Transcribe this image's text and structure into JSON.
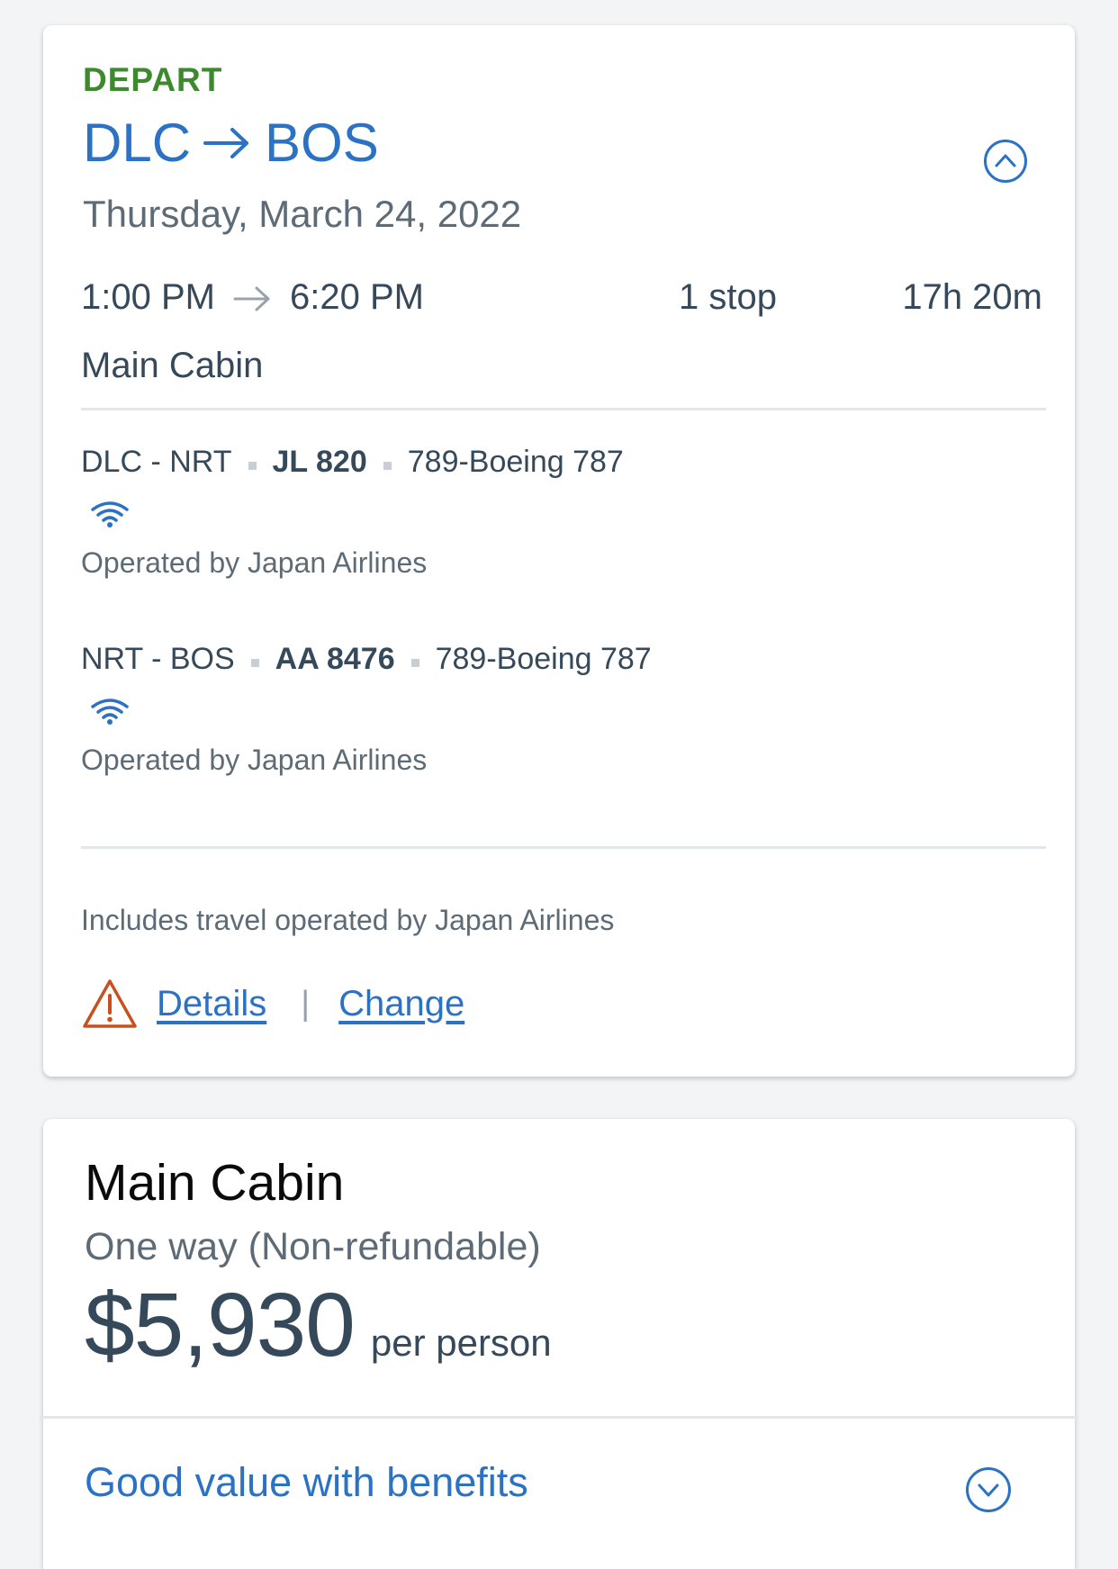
{
  "flight": {
    "label": "DEPART",
    "origin": "DLC",
    "destination": "BOS",
    "date": "Thursday, March 24, 2022",
    "depart_time": "1:00 PM",
    "arrive_time": "6:20 PM",
    "stops": "1 stop",
    "duration": "17h 20m",
    "cabin": "Main Cabin",
    "segments": [
      {
        "route": "DLC - NRT",
        "flight_number": "JL 820",
        "aircraft": "789-Boeing 787",
        "wifi_icon": "wifi-icon",
        "operated_by": "Operated by Japan Airlines"
      },
      {
        "route": "NRT - BOS",
        "flight_number": "AA 8476",
        "aircraft": "789-Boeing 787",
        "wifi_icon": "wifi-icon",
        "operated_by": "Operated by Japan Airlines"
      }
    ],
    "includes_note": "Includes travel operated by Japan Airlines",
    "details_link": "Details",
    "separator": "|",
    "change_link": "Change"
  },
  "fare": {
    "title": "Main Cabin",
    "subtitle": "One way (Non-refundable)",
    "price": "$5,930",
    "price_unit": "per person",
    "benefits_label": "Good value with benefits"
  },
  "colors": {
    "accent_blue": "#2b72c4",
    "depart_green": "#3d8a2e",
    "warning_orange": "#c8501e",
    "text_dark": "#36495a",
    "text_muted": "#5d6b77"
  }
}
